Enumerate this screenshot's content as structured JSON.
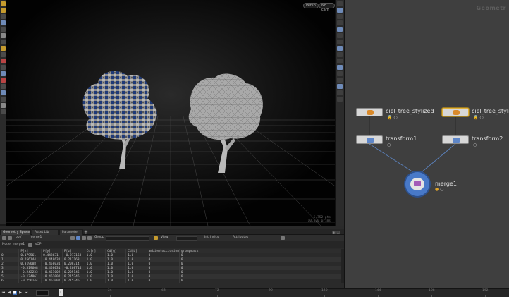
{
  "viewport": {
    "buttons": [
      "Persp",
      "No cam"
    ],
    "info_lines": [
      "5,752 pts",
      "10,520 prims"
    ]
  },
  "network": {
    "title": "Geometr",
    "nodes": {
      "tree1": "ciel_tree_stylized",
      "tree2": "ciel_tree_stylized",
      "transform1": "transform1",
      "transform2": "transform2",
      "merge1": "merge1"
    },
    "icons": {
      "lock": "🔒",
      "dot": "○",
      "warn": "●"
    }
  },
  "pane": {
    "tabs": [
      "Geometry Spreadsheet",
      "Asset Lib",
      "Parameter"
    ],
    "toolbar": {
      "node_path": "obj/",
      "node_name": "merge1",
      "group_label": "Group",
      "view_label": "View",
      "intrinsics": "Intrinsics",
      "attributes": "Attributes"
    },
    "filter": {
      "label": "Node: merge1",
      "filter_text": "sOP"
    },
    "columns": [
      "",
      "P[x]",
      "P[y]",
      "P[z]",
      "Cd[r]",
      "Cd[g]",
      "Cd[b]",
      "ambientocclusion",
      "groupmask"
    ],
    "rows": [
      [
        "0",
        "0.179561",
        "0.448631",
        "-0.217163",
        "1.0",
        "1.0",
        "1.0",
        "0",
        "0"
      ],
      [
        "1",
        "0.256144",
        "-0.448631",
        "0.217163",
        "1.0",
        "1.0",
        "1.0",
        "0",
        "0"
      ],
      [
        "2",
        "0.319608",
        "-0.458031",
        "0.208714",
        "1.0",
        "1.0",
        "1.0",
        "0",
        "0"
      ],
      [
        "3",
        "-0.319608",
        "-0.458031",
        "-0.208714",
        "1.0",
        "1.0",
        "1.0",
        "0",
        "0"
      ],
      [
        "4",
        "-0.242233",
        "-0.461002",
        "0.205146",
        "1.0",
        "1.0",
        "1.0",
        "0",
        "0"
      ],
      [
        "5",
        "-0.134861",
        "-0.461002",
        "0.215246",
        "1.0",
        "1.0",
        "1.0",
        "0",
        "0"
      ],
      [
        "6",
        "-0.256144",
        "-0.461002",
        "0.215246",
        "1.0",
        "1.0",
        "1.0",
        "0",
        "0"
      ]
    ]
  },
  "timeline": {
    "frame": "1",
    "ruler_labels": [
      "24",
      "48",
      "72",
      "96",
      "120",
      "144",
      "168",
      "192",
      "216"
    ],
    "play_buttons": [
      "⏮",
      "◀",
      "■",
      "▶",
      "⏭"
    ],
    "marker": "1"
  },
  "colors": {
    "accent": "#3d6db5",
    "selected_node": "#e1b13a",
    "merge_node": "#4879c8"
  }
}
